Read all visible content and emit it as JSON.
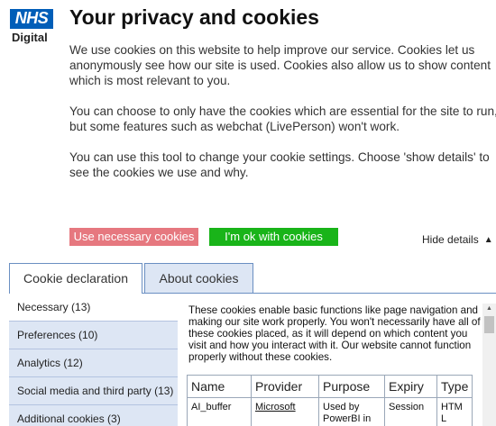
{
  "brand": {
    "logo_text": "NHS",
    "logo_sub": "Digital",
    "color": "#005eb8"
  },
  "heading": "Your privacy and cookies",
  "paragraphs": [
    "We use cookies on this website to help improve our service.  Cookies let us anonymously see how our site is used.  Cookies also allow us to show content which is most relevant to you.",
    "You can choose to only have the cookies which are essential for the site to run, but some features such as webchat (LivePerson) won't work.",
    "You can use this tool to change your cookie settings. Choose 'show details' to see the cookies we use and why."
  ],
  "buttons": {
    "necessary": "Use necessary cookies",
    "ok": "I'm ok with cookies"
  },
  "hide_details": "Hide details",
  "tabs": [
    "Cookie declaration",
    "About cookies"
  ],
  "categories": [
    "Necessary (13)",
    "Preferences (10)",
    "Analytics (12)",
    "Social media and third party (13)",
    "Additional cookies (3)"
  ],
  "category_description": "These cookies enable basic functions like page navigation and making our site work properly. You won't necessarily have all of these cookies placed, as it will depend on which content you visit and how you interact with it. Our website cannot function properly without these cookies.",
  "table": {
    "headers": [
      "Name",
      "Provider",
      "Purpose",
      "Expiry",
      "Type"
    ],
    "rows": [
      [
        "AI_buffer",
        "Microsoft",
        "Used by PowerBI in",
        "Session",
        "HTM L"
      ]
    ]
  },
  "colors": {
    "necessary_btn": "#e6787f",
    "ok_btn": "#19b419",
    "tab_border": "#6a8fc2"
  }
}
